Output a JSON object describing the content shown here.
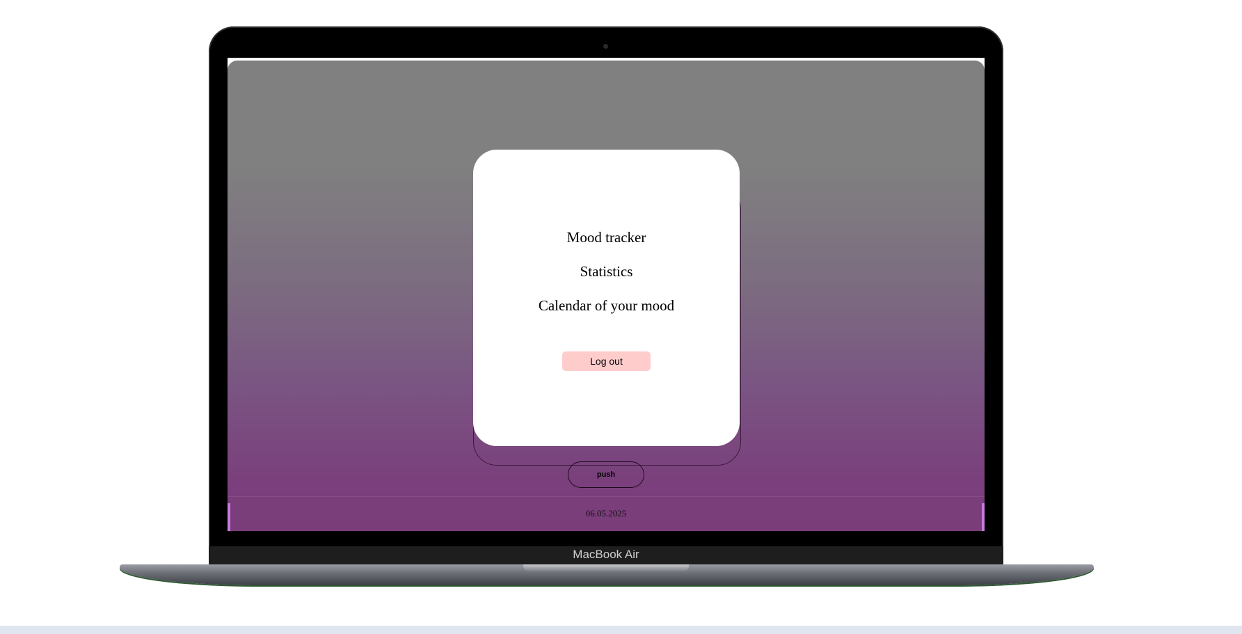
{
  "menu": {
    "mood_tracker": "Mood tracker",
    "statistics": "Statistics",
    "calendar": "Calendar of your mood"
  },
  "buttons": {
    "logout_label": "Log out",
    "push_label": "push"
  },
  "footer": {
    "date": "06.05.2025"
  },
  "device": {
    "label": "MacBook Air"
  },
  "colors": {
    "background_top": "#808080",
    "background_bottom": "#7a3d7a",
    "card": "#ffffff",
    "logout_button": "#ffcccc"
  }
}
